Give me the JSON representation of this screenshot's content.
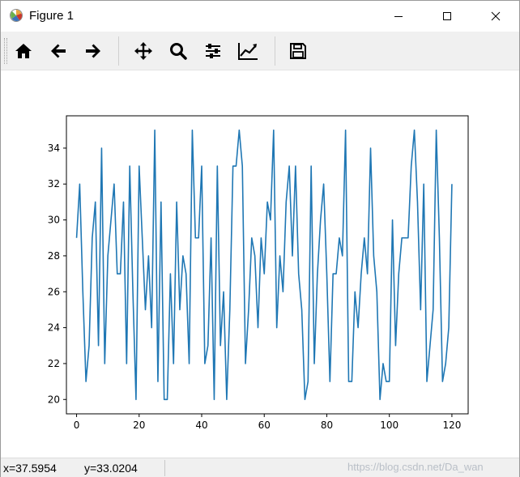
{
  "window": {
    "title": "Figure 1"
  },
  "toolbar": {
    "tools": [
      {
        "name": "home-icon"
      },
      {
        "name": "back-arrow-icon"
      },
      {
        "name": "forward-arrow-icon"
      },
      {
        "name": "pan-icon"
      },
      {
        "name": "zoom-icon"
      },
      {
        "name": "subplots-icon"
      },
      {
        "name": "customize-icon"
      },
      {
        "name": "save-icon"
      }
    ]
  },
  "status": {
    "x_readout": "x=37.5954",
    "y_readout": "y=33.0204"
  },
  "watermark": "https://blog.csdn.net/Da_wan",
  "colors": {
    "line": "#1f77b4",
    "toolbar_bg": "#f0f0f0"
  },
  "chart_data": {
    "type": "line",
    "xlim": [
      -3.25,
      125.2
    ],
    "ylim": [
      19.2,
      35.8
    ],
    "xticks": [
      0,
      20,
      40,
      60,
      80,
      100,
      120
    ],
    "yticks": [
      20,
      22,
      24,
      26,
      28,
      30,
      32,
      34
    ],
    "grid": false,
    "legend": "none",
    "series": [
      {
        "values": [
          29,
          32,
          26,
          21,
          23,
          29,
          31,
          23,
          34,
          22,
          28,
          30,
          32,
          27,
          27,
          31,
          22,
          33,
          26,
          20,
          33,
          29,
          25,
          28,
          24,
          35,
          21,
          31,
          20,
          20,
          27,
          22,
          31,
          25,
          28,
          27,
          22,
          35,
          29,
          29,
          33,
          22,
          23,
          29,
          20,
          33,
          23,
          26,
          20,
          25,
          33,
          33,
          35,
          33,
          22,
          25,
          29,
          28,
          24,
          29,
          27,
          31,
          30,
          35,
          24,
          28,
          26,
          31,
          33,
          28,
          33,
          27,
          25,
          20,
          21,
          33,
          22,
          27,
          30,
          32,
          27,
          21,
          27,
          27,
          29,
          28,
          35,
          21,
          21,
          26,
          24,
          27,
          29,
          27,
          34,
          28,
          26,
          20,
          22,
          21,
          21,
          30,
          23,
          27,
          29,
          29,
          29,
          33,
          35,
          31,
          25,
          32,
          21,
          23,
          25,
          35,
          29,
          21,
          22,
          24,
          32
        ]
      }
    ]
  }
}
